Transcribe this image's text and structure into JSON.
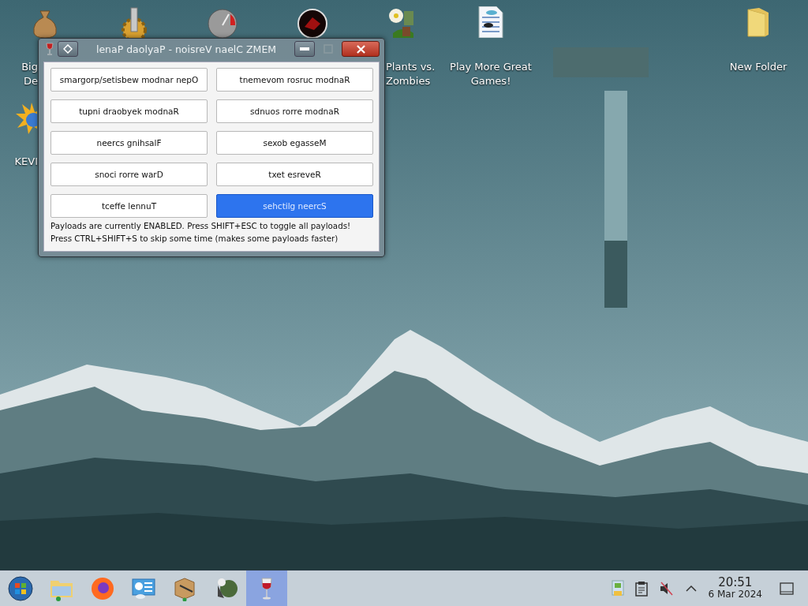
{
  "desktop_icons": [
    {
      "kind": "moneybag",
      "lines": [
        "Big",
        "De"
      ]
    },
    {
      "kind": "gear"
    },
    {
      "kind": "gauge"
    },
    {
      "kind": "orb"
    },
    {
      "kind": "plant",
      "lines": [
        "Plants vs.",
        "Zombies"
      ]
    },
    {
      "kind": "document",
      "lines": [
        "Play More Great",
        "Games!"
      ]
    },
    {
      "kind": "folder",
      "lines": [
        "New Folder"
      ]
    },
    {
      "kind": "sun",
      "lines": [
        "KEVI"
      ]
    }
  ],
  "window": {
    "title": "lenaP daolyaP - noisreV naelC ZMEM",
    "buttons": [
      {
        "label": "smargorp/setisbew modnar nepO",
        "selected": false
      },
      {
        "label": "tnemevom rosruc modnaR",
        "selected": false
      },
      {
        "label": "tupni draobyek modnaR",
        "selected": false
      },
      {
        "label": "sdnuos rorre modnaR",
        "selected": false
      },
      {
        "label": "neercs gnihsalF",
        "selected": false
      },
      {
        "label": "sexob egasseM",
        "selected": false
      },
      {
        "label": "snoci rorre warD",
        "selected": false
      },
      {
        "label": "txet esreveR",
        "selected": false
      },
      {
        "label": "tceffe lennuT",
        "selected": false
      },
      {
        "label": "sehctilg neercS",
        "selected": true
      }
    ],
    "notes": [
      "Payloads are currently ENABLED. Press SHIFT+ESC to toggle all payloads!",
      "Press CTRL+SHIFT+S to skip some time (makes some payloads faster)"
    ]
  },
  "taskbar": {
    "apps": [
      {
        "kind": "start",
        "active": false
      },
      {
        "kind": "files",
        "active": false
      },
      {
        "kind": "firefox",
        "active": false
      },
      {
        "kind": "panel",
        "active": false
      },
      {
        "kind": "package",
        "active": false
      },
      {
        "kind": "plant",
        "active": false
      },
      {
        "kind": "wine",
        "active": true
      }
    ],
    "time": "20:51",
    "date": "6 Mar 2024"
  }
}
